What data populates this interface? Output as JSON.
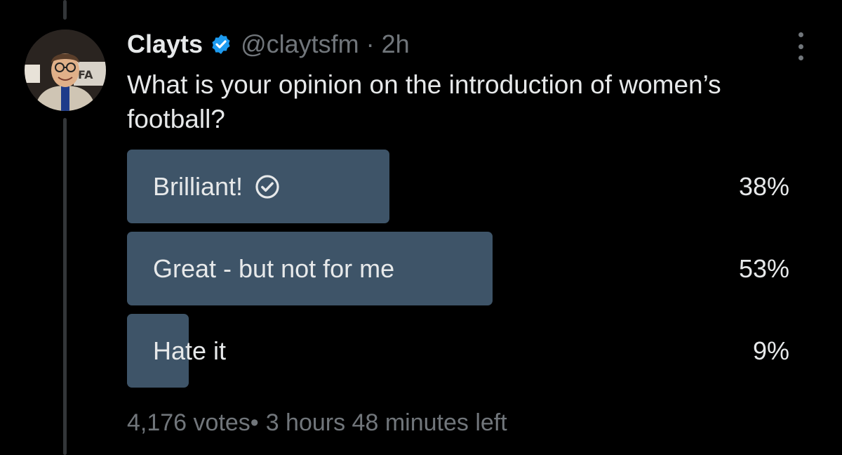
{
  "tweet": {
    "display_name": "Clayts",
    "handle": "@claytsfm",
    "separator": "·",
    "time": "2h",
    "question": "What is your opinion on the introduction of women’s football?",
    "avatar_icon": "profile-photo",
    "verified_icon": "verified-badge-icon",
    "more_icon": "vertical-ellipsis-icon"
  },
  "poll": {
    "options": [
      {
        "label": "Brilliant!",
        "percent_text": "38%",
        "share": 0.38,
        "voted": true
      },
      {
        "label": "Great - but not for me",
        "percent_text": "53%",
        "share": 0.53,
        "voted": false
      },
      {
        "label": "Hate it",
        "percent_text": "9%",
        "share": 0.09,
        "voted": false
      }
    ],
    "votes": "4,176 votes",
    "separator": "•",
    "time_left": "3 hours 48 minutes left"
  },
  "colors": {
    "background": "#000000",
    "text_primary": "#e7e9ea",
    "text_secondary": "#71767b",
    "bar_fill": "#3e5468",
    "verified_blue": "#1d9bf0"
  }
}
